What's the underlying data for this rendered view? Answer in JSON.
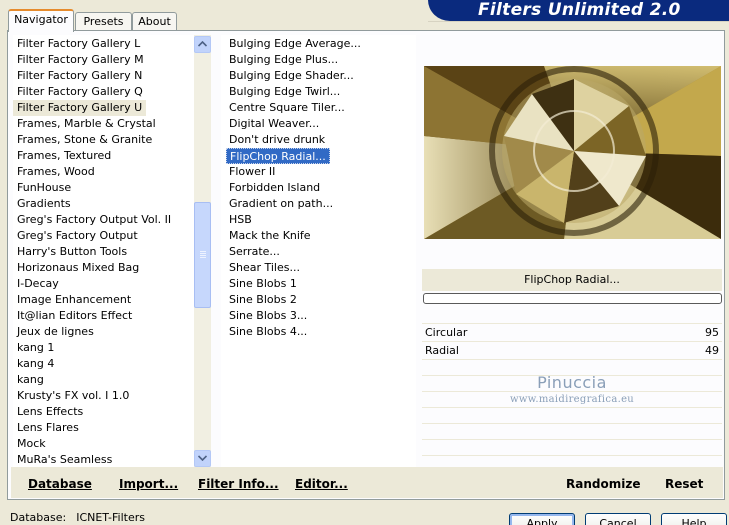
{
  "tabs": [
    {
      "label": "Navigator",
      "active": true
    },
    {
      "label": "Presets",
      "active": false
    },
    {
      "label": "About",
      "active": false
    }
  ],
  "app_title": "Filters Unlimited 2.0",
  "categories": [
    "Filter Factory Gallery L",
    "Filter Factory Gallery M",
    "Filter Factory Gallery N",
    "Filter Factory Gallery Q",
    "Filter Factory Gallery U",
    "Frames, Marble & Crystal",
    "Frames, Stone & Granite",
    "Frames, Textured",
    "Frames, Wood",
    "FunHouse",
    "Gradients",
    "Greg's Factory Output Vol. II",
    "Greg's Factory Output",
    "Harry's Button Tools",
    "Horizonaus Mixed Bag",
    "I-Decay",
    "Image Enhancement",
    "It@lian Editors Effect",
    "Jeux de lignes",
    "kang 1",
    "kang 4",
    "kang",
    "Krusty's FX vol. I 1.0",
    "Lens Effects",
    "Lens Flares",
    "Mock",
    "MuRa's Seamless"
  ],
  "selected_category": "Filter Factory Gallery U",
  "filters": [
    "Bulging Edge Average...",
    "Bulging Edge Plus...",
    "Bulging Edge Shader...",
    "Bulging Edge Twirl...",
    "Centre Square Tiler...",
    "Digital Weaver...",
    "Don't drive drunk",
    "FlipChop Radial...",
    "Flower II",
    "Forbidden Island",
    "Gradient on path...",
    "HSB",
    "Mack the Knife",
    "Serrate...",
    "Shear Tiles...",
    "Sine Blobs 1",
    "Sine Blobs 2",
    "Sine Blobs 3...",
    "Sine Blobs 4..."
  ],
  "selected_filter": "FlipChop Radial...",
  "current_filter_name": "FlipChop Radial...",
  "progress": 0,
  "params": [
    {
      "label": "Circular",
      "value": "95"
    },
    {
      "label": "Radial",
      "value": "49"
    }
  ],
  "watermark": {
    "line1": "Pinuccia",
    "line2": "www.maidiregrafica.eu"
  },
  "bottom_buttons": {
    "database": "Database",
    "import": "Import...",
    "filter_info": "Filter Info...",
    "editor": "Editor...",
    "randomize": "Randomize",
    "reset": "Reset"
  },
  "status": {
    "label": "Database:",
    "value": "ICNET-Filters"
  },
  "dialog_buttons": {
    "apply": "Apply",
    "cancel": "Cancel",
    "help": "Help"
  },
  "colors": {
    "selection": "#316ac5",
    "banner": "#0a2a7e",
    "active_tab_accent": "#e68b2c"
  },
  "icons": {
    "scroll_up": "scroll-up-arrow",
    "scroll_down": "scroll-down-arrow"
  }
}
